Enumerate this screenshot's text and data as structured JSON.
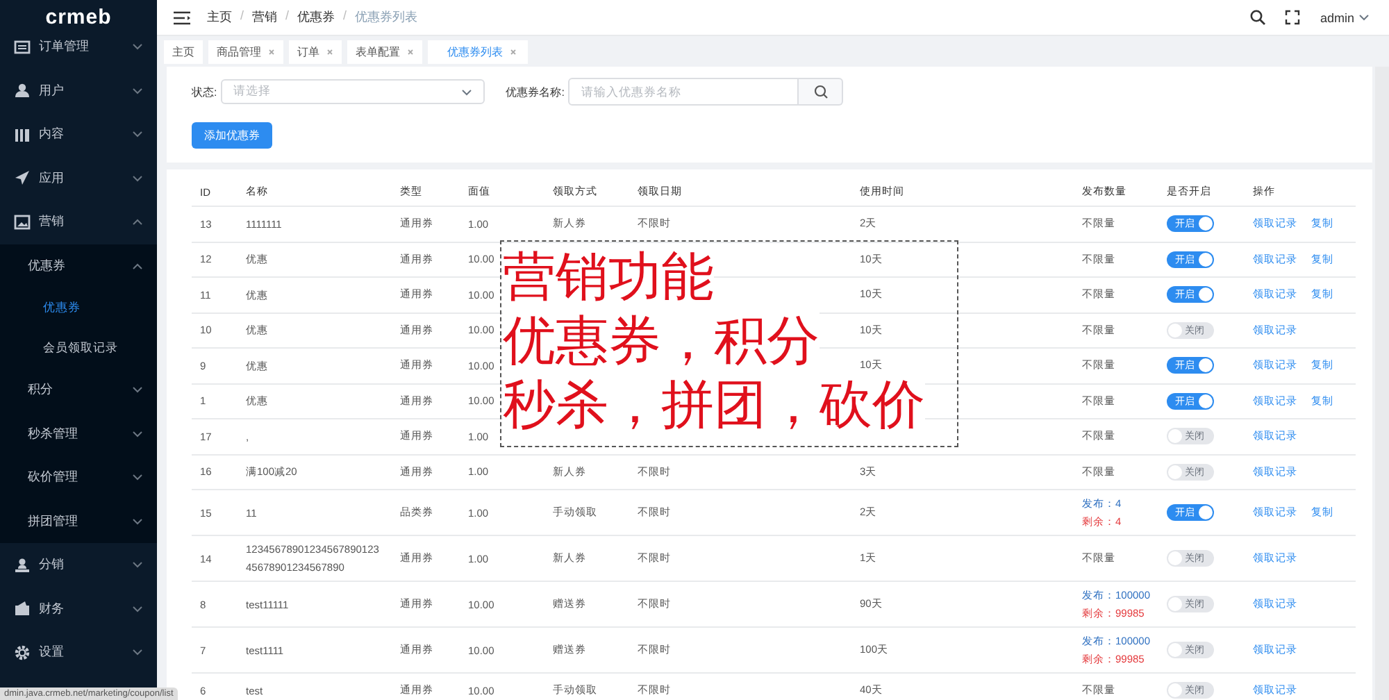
{
  "sidebar": {
    "logo": "crmeb",
    "items": [
      {
        "label": "订单管理",
        "expanded": false
      },
      {
        "label": "用户",
        "expanded": false
      },
      {
        "label": "内容",
        "expanded": false
      },
      {
        "label": "应用",
        "expanded": false
      },
      {
        "label": "营销",
        "expanded": true,
        "children": [
          {
            "label": "优惠券",
            "expanded": true,
            "children": [
              {
                "label": "优惠券",
                "selected": true
              },
              {
                "label": "会员领取记录",
                "selected": false
              }
            ]
          },
          {
            "label": "积分",
            "expanded": false
          },
          {
            "label": "秒杀管理",
            "expanded": false
          },
          {
            "label": "砍价管理",
            "expanded": false
          },
          {
            "label": "拼团管理",
            "expanded": false
          }
        ]
      },
      {
        "label": "分销",
        "expanded": false
      },
      {
        "label": "财务",
        "expanded": false
      },
      {
        "label": "设置",
        "expanded": false
      }
    ]
  },
  "header": {
    "breadcrumbs": [
      "主页",
      "营销",
      "优惠券",
      "优惠券列表"
    ],
    "breadcrumb_separator": "/",
    "user": "admin"
  },
  "tabs": [
    {
      "label": "主页",
      "closable": false,
      "selected": false
    },
    {
      "label": "商品管理",
      "closable": true,
      "selected": false
    },
    {
      "label": "订单",
      "closable": true,
      "selected": false
    },
    {
      "label": "表单配置",
      "closable": true,
      "selected": false
    },
    {
      "label": "优惠券列表",
      "closable": true,
      "selected": true
    }
  ],
  "filters": {
    "status_label": "状态:",
    "status_placeholder": "请选择",
    "name_label": "优惠券名称:",
    "name_placeholder": "请输入优惠券名称",
    "add_button": "添加优惠券"
  },
  "table": {
    "columns": [
      "ID",
      "名称",
      "类型",
      "面值",
      "领取方式",
      "领取日期",
      "使用时间",
      "发布数量",
      "是否开启",
      "操作"
    ],
    "rows": [
      {
        "id": "13",
        "name": "1111111",
        "type": "通用券",
        "value": "1.00",
        "method": "新人券",
        "date": "不限时",
        "duration": "2天",
        "publish": {
          "kind": "text",
          "text": "不限量"
        },
        "enabled": true,
        "switch_label": "开启",
        "actions": [
          "领取记录",
          "复制"
        ]
      },
      {
        "id": "12",
        "name": "优惠",
        "type": "通用券",
        "value": "10.00",
        "duration": "10天",
        "publish": {
          "kind": "text",
          "text": "不限量"
        },
        "enabled": true,
        "switch_label": "开启",
        "actions": [
          "领取记录",
          "复制"
        ]
      },
      {
        "id": "11",
        "name": "优惠",
        "type": "通用券",
        "value": "10.00",
        "duration": "10天",
        "publish": {
          "kind": "text",
          "text": "不限量"
        },
        "enabled": true,
        "switch_label": "开启",
        "actions": [
          "领取记录",
          "复制"
        ]
      },
      {
        "id": "10",
        "name": "优惠",
        "type": "通用券",
        "value": "10.00",
        "duration": "10天",
        "publish": {
          "kind": "text",
          "text": "不限量"
        },
        "enabled": false,
        "switch_label": "关闭",
        "actions": [
          "领取记录"
        ]
      },
      {
        "id": "9",
        "name": "优惠",
        "type": "通用券",
        "value": "10.00",
        "duration": "10天",
        "publish": {
          "kind": "text",
          "text": "不限量"
        },
        "enabled": true,
        "switch_label": "开启",
        "actions": [
          "领取记录",
          "复制"
        ]
      },
      {
        "id": "1",
        "name": "优惠",
        "type": "通用券",
        "value": "10.00",
        "publish": {
          "kind": "text",
          "text": "不限量"
        },
        "enabled": true,
        "switch_label": "开启",
        "actions": [
          "领取记录",
          "复制"
        ]
      },
      {
        "id": "17",
        "name": ",",
        "type": "通用券",
        "value": "1.00",
        "publish": {
          "kind": "text",
          "text": "不限量"
        },
        "enabled": false,
        "switch_label": "关闭",
        "actions": [
          "领取记录"
        ]
      },
      {
        "id": "16",
        "name": "满100减20",
        "type": "通用券",
        "value": "1.00",
        "method": "新人券",
        "date": "不限时",
        "duration": "3天",
        "publish": {
          "kind": "text",
          "text": "不限量"
        },
        "enabled": false,
        "switch_label": "关闭",
        "actions": [
          "领取记录"
        ]
      },
      {
        "id": "15",
        "name": "11",
        "type": "品类券",
        "value": "1.00",
        "method": "手动领取",
        "date": "不限时",
        "duration": "2天",
        "publish": {
          "kind": "counts",
          "issued": "发布：4",
          "remaining": "剩余：4"
        },
        "enabled": true,
        "switch_label": "开启",
        "actions": [
          "领取记录",
          "复制"
        ]
      },
      {
        "id": "14",
        "name": "1234567890123456789012345678901234567890",
        "type": "通用券",
        "value": "1.00",
        "method": "新人券",
        "date": "不限时",
        "duration": "1天",
        "publish": {
          "kind": "text",
          "text": "不限量"
        },
        "enabled": false,
        "switch_label": "关闭",
        "actions": [
          "领取记录"
        ]
      },
      {
        "id": "8",
        "name": "test11111",
        "type": "通用券",
        "value": "10.00",
        "method": "赠送券",
        "date": "不限时",
        "duration": "90天",
        "publish": {
          "kind": "counts",
          "issued": "发布：100000",
          "remaining": "剩余：99985"
        },
        "enabled": false,
        "switch_label": "关闭",
        "actions": [
          "领取记录"
        ]
      },
      {
        "id": "7",
        "name": "test1111",
        "type": "通用券",
        "value": "10.00",
        "method": "赠送券",
        "date": "不限时",
        "duration": "100天",
        "publish": {
          "kind": "counts",
          "issued": "发布：100000",
          "remaining": "剩余：99985"
        },
        "enabled": false,
        "switch_label": "关闭",
        "actions": [
          "领取记录"
        ]
      },
      {
        "id": "6",
        "name": "test",
        "type": "通用券",
        "value": "10.00",
        "method": "手动领取",
        "date": "不限时",
        "duration": "40天",
        "publish": {
          "kind": "text",
          "text": "不限量"
        },
        "enabled": false,
        "switch_label": "关闭",
        "actions": [
          "领取记录"
        ]
      }
    ]
  },
  "annotation": {
    "lines": [
      "营销功能",
      "优惠券，积分",
      "秒杀，拼团，砍价"
    ]
  },
  "status_url": "dmin.java.crmeb.net/marketing/coupon/list"
}
